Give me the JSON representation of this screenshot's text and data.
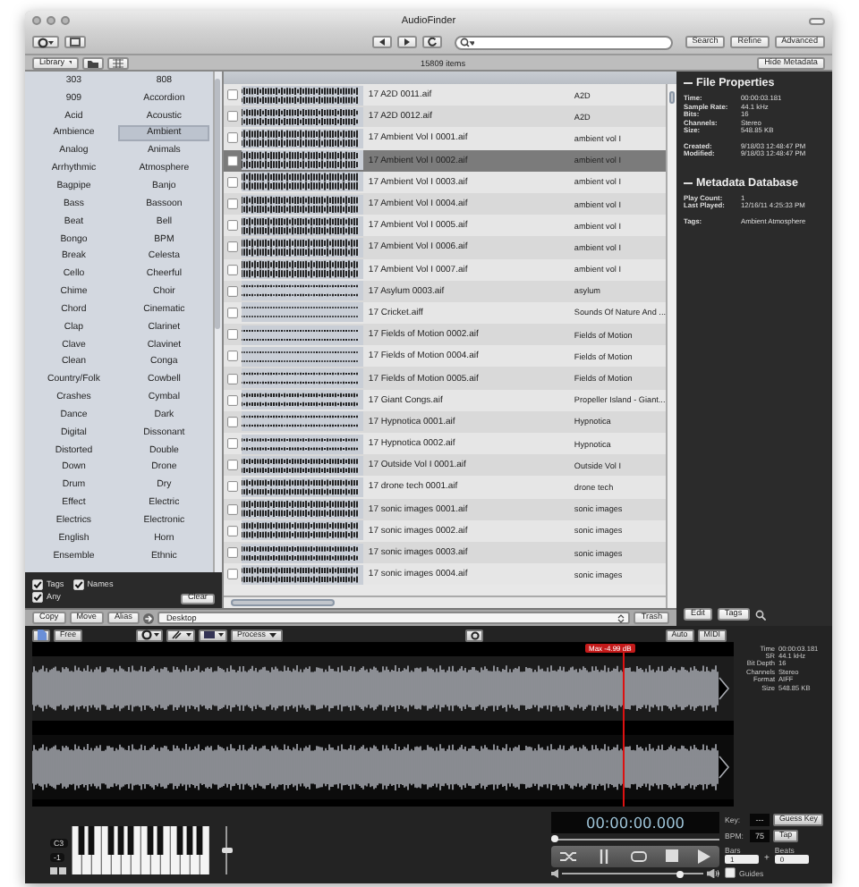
{
  "window": {
    "title": "AudioFinder"
  },
  "toolbar": {
    "buttons": [
      "Search",
      "Refine",
      "Advanced"
    ]
  },
  "library_bar": {
    "source": "Library",
    "count": "15809 items",
    "hide_button": "Hide Metadata"
  },
  "tags": [
    {
      "label": "303",
      "selected": false
    },
    {
      "label": "808",
      "selected": false
    },
    {
      "label": "909",
      "selected": false
    },
    {
      "label": "Accordion",
      "selected": false
    },
    {
      "label": "Acid",
      "selected": false
    },
    {
      "label": "Acoustic",
      "selected": false
    },
    {
      "label": "Ambience",
      "selected": false
    },
    {
      "label": "Ambient",
      "selected": true
    },
    {
      "label": "Analog",
      "selected": false
    },
    {
      "label": "Animals",
      "selected": false
    },
    {
      "label": "Arrhythmic",
      "selected": false
    },
    {
      "label": "Atmosphere",
      "selected": false
    },
    {
      "label": "Bagpipe",
      "selected": false
    },
    {
      "label": "Banjo",
      "selected": false
    },
    {
      "label": "Bass",
      "selected": false
    },
    {
      "label": "Bassoon",
      "selected": false
    },
    {
      "label": "Beat",
      "selected": false
    },
    {
      "label": "Bell",
      "selected": false
    },
    {
      "label": "Bongo",
      "selected": false
    },
    {
      "label": "BPM",
      "selected": false
    },
    {
      "label": "Break",
      "selected": false
    },
    {
      "label": "Celesta",
      "selected": false
    },
    {
      "label": "Cello",
      "selected": false
    },
    {
      "label": "Cheerful",
      "selected": false
    },
    {
      "label": "Chime",
      "selected": false
    },
    {
      "label": "Choir",
      "selected": false
    },
    {
      "label": "Chord",
      "selected": false
    },
    {
      "label": "Cinematic",
      "selected": false
    },
    {
      "label": "Clap",
      "selected": false
    },
    {
      "label": "Clarinet",
      "selected": false
    },
    {
      "label": "Clave",
      "selected": false
    },
    {
      "label": "Clavinet",
      "selected": false
    },
    {
      "label": "Clean",
      "selected": false
    },
    {
      "label": "Conga",
      "selected": false
    },
    {
      "label": "Country/Folk",
      "selected": false
    },
    {
      "label": "Cowbell",
      "selected": false
    },
    {
      "label": "Crashes",
      "selected": false
    },
    {
      "label": "Cymbal",
      "selected": false
    },
    {
      "label": "Dance",
      "selected": false
    },
    {
      "label": "Dark",
      "selected": false
    },
    {
      "label": "Digital",
      "selected": false
    },
    {
      "label": "Dissonant",
      "selected": false
    },
    {
      "label": "Distorted",
      "selected": false
    },
    {
      "label": "Double",
      "selected": false
    },
    {
      "label": "Down",
      "selected": false
    },
    {
      "label": "Drone",
      "selected": false
    },
    {
      "label": "Drum",
      "selected": false
    },
    {
      "label": "Dry",
      "selected": false
    },
    {
      "label": "Effect",
      "selected": false
    },
    {
      "label": "Electric",
      "selected": false
    },
    {
      "label": "Electrics",
      "selected": false
    },
    {
      "label": "Electronic",
      "selected": false
    },
    {
      "label": "English",
      "selected": false
    },
    {
      "label": "Horn",
      "selected": false
    },
    {
      "label": "Ensemble",
      "selected": false
    },
    {
      "label": "Ethnic",
      "selected": false
    }
  ],
  "tag_options": [
    {
      "label": "Tags",
      "checked": true
    },
    {
      "label": "Names",
      "checked": true
    },
    {
      "label": "Any",
      "checked": true
    }
  ],
  "clear_button": "Clear",
  "files": [
    {
      "name": "17 A2D 0011.aif",
      "album": "A2D",
      "checked": false,
      "selected": false
    },
    {
      "name": "17 A2D 0012.aif",
      "album": "A2D",
      "checked": false,
      "selected": false
    },
    {
      "name": "17 Ambient Vol I 0001.aif",
      "album": "ambient vol I",
      "checked": false,
      "selected": false
    },
    {
      "name": "17 Ambient Vol I 0002.aif",
      "album": "ambient vol I",
      "checked": false,
      "selected": true
    },
    {
      "name": "17 Ambient Vol I 0003.aif",
      "album": "ambient vol I",
      "checked": false,
      "selected": false
    },
    {
      "name": "17 Ambient Vol I 0004.aif",
      "album": "ambient vol I",
      "checked": false,
      "selected": false
    },
    {
      "name": "17 Ambient Vol I 0005.aif",
      "album": "ambient vol I",
      "checked": false,
      "selected": false
    },
    {
      "name": "17 Ambient Vol I 0006.aif",
      "album": "ambient vol I",
      "checked": false,
      "selected": false
    },
    {
      "name": "17 Ambient Vol I 0007.aif",
      "album": "ambient vol I",
      "checked": false,
      "selected": false
    },
    {
      "name": "17 Asylum 0003.aif",
      "album": "asylum",
      "checked": false,
      "selected": false
    },
    {
      "name": "17 Cricket.aiff",
      "album": "Sounds Of Nature And ...",
      "checked": false,
      "selected": false
    },
    {
      "name": "17 Fields of Motion 0002.aif",
      "album": "Fields of Motion",
      "checked": false,
      "selected": false
    },
    {
      "name": "17 Fields of Motion 0004.aif",
      "album": "Fields of Motion",
      "checked": false,
      "selected": false
    },
    {
      "name": "17 Fields of Motion 0005.aif",
      "album": "Fields of Motion",
      "checked": false,
      "selected": false
    },
    {
      "name": "17 Giant Congs.aif",
      "album": "Propeller Island - Giant...",
      "checked": false,
      "selected": false
    },
    {
      "name": "17 Hypnotica 0001.aif",
      "album": "Hypnotica",
      "checked": false,
      "selected": false
    },
    {
      "name": "17 Hypnotica 0002.aif",
      "album": "Hypnotica",
      "checked": false,
      "selected": false
    },
    {
      "name": "17 Outside Vol I 0001.aif",
      "album": "Outside Vol I",
      "checked": false,
      "selected": false
    },
    {
      "name": "17 drone tech 0001.aif",
      "album": "drone tech",
      "checked": false,
      "selected": false
    },
    {
      "name": "17 sonic images 0001.aif",
      "album": "sonic images",
      "checked": false,
      "selected": false
    },
    {
      "name": "17 sonic images 0002.aif",
      "album": "sonic images",
      "checked": false,
      "selected": false
    },
    {
      "name": "17 sonic images 0003.aif",
      "album": "sonic images",
      "checked": false,
      "selected": false
    },
    {
      "name": "17 sonic images 0004.aif",
      "album": "sonic images",
      "checked": false,
      "selected": false
    }
  ],
  "path_bar": {
    "buttons": [
      "Copy",
      "Move",
      "Alias"
    ],
    "destination": "Desktop",
    "trash_button": "Trash"
  },
  "sections": [
    {
      "title": "File Properties",
      "groups": [
        [
          {
            "label": "Time:",
            "value": "00:00:03.181"
          },
          {
            "label": "Sample Rate:",
            "value": "44.1 kHz"
          },
          {
            "label": "Bits:",
            "value": "16"
          },
          {
            "label": "Channels:",
            "value": "Stereo"
          },
          {
            "label": "Size:",
            "value": "548.85 KB"
          }
        ],
        [
          {
            "label": "Created:",
            "value": "9/18/03 12:48:47 PM"
          },
          {
            "label": "Modified:",
            "value": "9/18/03 12:48:47 PM"
          }
        ]
      ]
    },
    {
      "title": "Metadata Database",
      "groups": [
        [
          {
            "label": "Play Count:",
            "value": "1"
          },
          {
            "label": "Last Played:",
            "value": "12/16/11 4:25:33 PM"
          }
        ],
        [
          {
            "label": "Tags:",
            "value": "Ambient Atmosphere"
          }
        ]
      ]
    }
  ],
  "panel_buttons": [
    "Edit",
    "Tags"
  ],
  "player": {
    "free_button": "Free",
    "process_menu": "Process",
    "right_buttons": [
      "Auto",
      "MIDI"
    ],
    "max_label": "Max -4.99 dB",
    "info": [
      {
        "label": "Time",
        "value": "00:00:03.181"
      },
      {
        "label": "SR",
        "value": "44.1 kHz"
      },
      {
        "label": "Bit Depth",
        "value": "16"
      },
      {
        "label": "Channels",
        "value": "Stereo"
      },
      {
        "label": "Format",
        "value": "AIFF"
      },
      {
        "label": "Size",
        "value": "548.85 KB"
      }
    ],
    "octave": "C3",
    "transpose": "-1",
    "keyboard_slider": {
      "level": 0.5
    },
    "time": "00:00:00.000",
    "position": {
      "level": 0.0
    },
    "volume": {
      "level": 0.85
    },
    "key": {
      "label": "Key:",
      "value": "---",
      "button": "Guess Key"
    },
    "bpm": {
      "label": "BPM:",
      "value": "75",
      "button": "Tap"
    },
    "bars": {
      "label": "Bars",
      "value": "1"
    },
    "plus": "+",
    "beats": {
      "label": "Beats",
      "value": "0"
    },
    "guides": {
      "label": "Guides",
      "checked": false
    }
  }
}
